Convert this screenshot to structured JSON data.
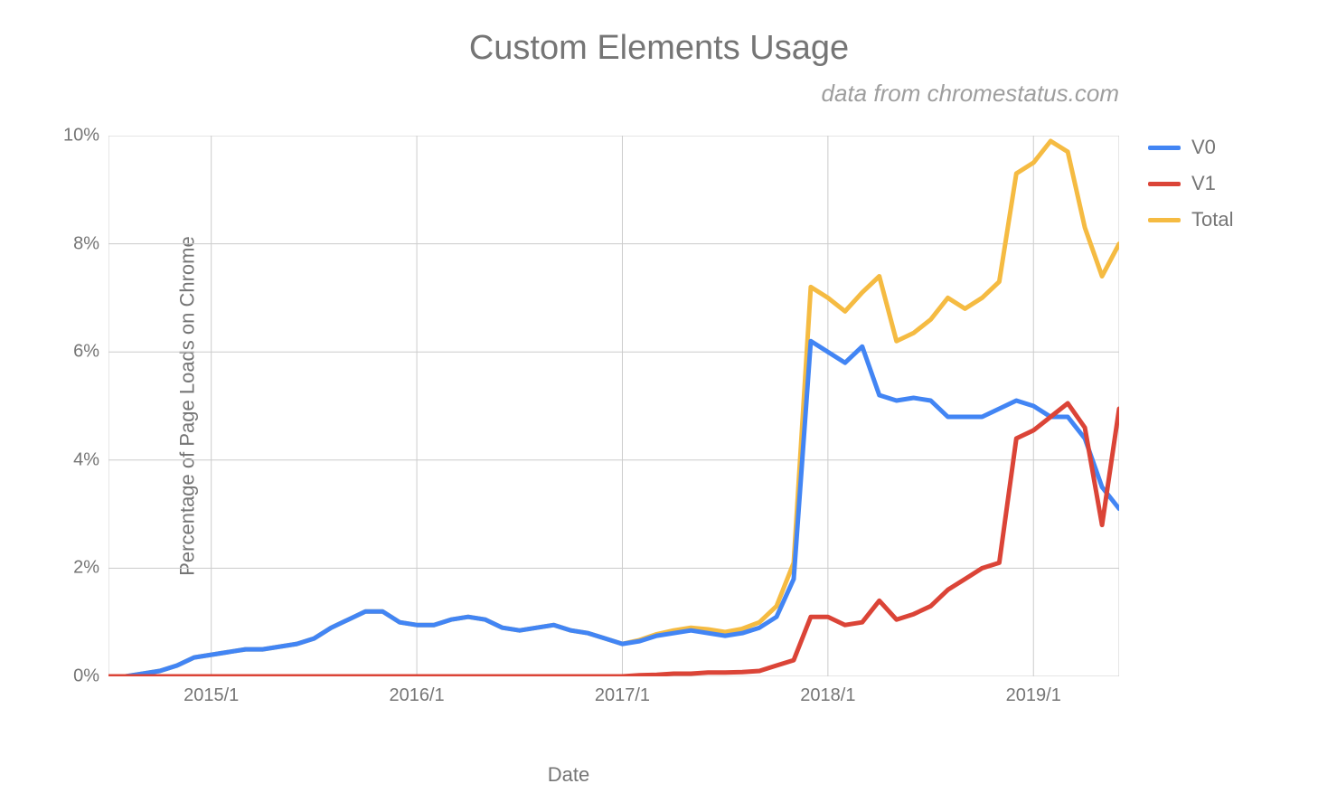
{
  "chart_data": {
    "type": "line",
    "title": "Custom Elements Usage",
    "subtitle": "data from chromestatus.com",
    "xlabel": "Date",
    "ylabel": "Percentage of Page Loads on Chrome",
    "ylim": [
      0,
      10
    ],
    "yticks": [
      "0%",
      "2%",
      "4%",
      "6%",
      "8%",
      "10%"
    ],
    "xticks": [
      "2015/1",
      "2016/1",
      "2017/1",
      "2018/1",
      "2019/1"
    ],
    "x": [
      "2014-07",
      "2014-08",
      "2014-09",
      "2014-10",
      "2014-11",
      "2014-12",
      "2015-01",
      "2015-02",
      "2015-03",
      "2015-04",
      "2015-05",
      "2015-06",
      "2015-07",
      "2015-08",
      "2015-09",
      "2015-10",
      "2015-11",
      "2015-12",
      "2016-01",
      "2016-02",
      "2016-03",
      "2016-04",
      "2016-05",
      "2016-06",
      "2016-07",
      "2016-08",
      "2016-09",
      "2016-10",
      "2016-11",
      "2016-12",
      "2017-01",
      "2017-02",
      "2017-03",
      "2017-04",
      "2017-05",
      "2017-06",
      "2017-07",
      "2017-08",
      "2017-09",
      "2017-10",
      "2017-11",
      "2017-12",
      "2018-01",
      "2018-02",
      "2018-03",
      "2018-04",
      "2018-05",
      "2018-06",
      "2018-07",
      "2018-08",
      "2018-09",
      "2018-10",
      "2018-11",
      "2018-12",
      "2019-01",
      "2019-02",
      "2019-03",
      "2019-04",
      "2019-05",
      "2019-06"
    ],
    "series": [
      {
        "name": "V0",
        "color": "#4285f4",
        "values": [
          0.0,
          0.0,
          0.05,
          0.1,
          0.2,
          0.35,
          0.4,
          0.45,
          0.5,
          0.5,
          0.55,
          0.6,
          0.7,
          0.9,
          1.05,
          1.2,
          1.2,
          1.0,
          0.95,
          0.95,
          1.05,
          1.1,
          1.05,
          0.9,
          0.85,
          0.9,
          0.95,
          0.85,
          0.8,
          0.7,
          0.6,
          0.65,
          0.75,
          0.8,
          0.85,
          0.8,
          0.75,
          0.8,
          0.9,
          1.1,
          1.8,
          6.2,
          6.0,
          5.8,
          6.1,
          5.2,
          5.1,
          5.15,
          5.1,
          4.8,
          4.8,
          4.8,
          4.95,
          5.1,
          5.0,
          4.8,
          4.8,
          4.4,
          3.5,
          3.1
        ]
      },
      {
        "name": "V1",
        "color": "#db4437",
        "values": [
          0.0,
          0.0,
          0.0,
          0.0,
          0.0,
          0.0,
          0.0,
          0.0,
          0.0,
          0.0,
          0.0,
          0.0,
          0.0,
          0.0,
          0.0,
          0.0,
          0.0,
          0.0,
          0.0,
          0.0,
          0.0,
          0.0,
          0.0,
          0.0,
          0.0,
          0.0,
          0.0,
          0.0,
          0.0,
          0.0,
          0.0,
          0.02,
          0.03,
          0.05,
          0.05,
          0.07,
          0.07,
          0.08,
          0.1,
          0.2,
          0.3,
          1.1,
          1.1,
          0.95,
          1.0,
          1.4,
          1.05,
          1.15,
          1.3,
          1.6,
          1.8,
          2.0,
          2.1,
          4.4,
          4.55,
          4.8,
          5.05,
          4.6,
          2.8,
          4.95
        ]
      },
      {
        "name": "Total",
        "color": "#f5bb42",
        "values": [
          0.0,
          0.0,
          0.05,
          0.1,
          0.2,
          0.35,
          0.4,
          0.45,
          0.5,
          0.5,
          0.55,
          0.6,
          0.7,
          0.9,
          1.05,
          1.2,
          1.2,
          1.0,
          0.95,
          0.95,
          1.05,
          1.1,
          1.05,
          0.9,
          0.85,
          0.9,
          0.95,
          0.85,
          0.8,
          0.7,
          0.6,
          0.67,
          0.78,
          0.85,
          0.9,
          0.87,
          0.82,
          0.88,
          1.0,
          1.3,
          2.1,
          7.2,
          7.0,
          6.75,
          7.1,
          7.4,
          6.2,
          6.35,
          6.6,
          7.0,
          6.8,
          7.0,
          7.3,
          9.3,
          9.5,
          9.9,
          9.7,
          8.3,
          7.4,
          8.0
        ]
      }
    ],
    "legend": [
      "V0",
      "V1",
      "Total"
    ]
  }
}
